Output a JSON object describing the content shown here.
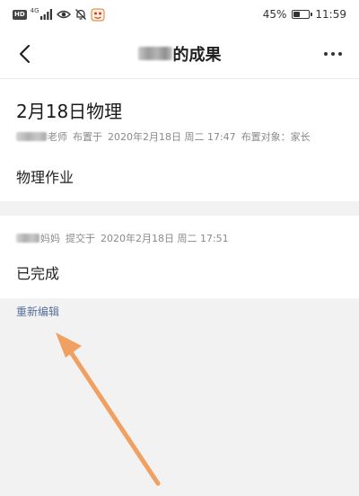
{
  "status_bar": {
    "hd_badge": "HD",
    "network_label": "4G",
    "battery_text": "45%",
    "battery_level": 0.45,
    "time": "11:59"
  },
  "nav": {
    "title_suffix": "的成果",
    "back_icon": "chevron-left-icon",
    "more_icon": "more-dots-icon"
  },
  "assignment": {
    "title": "2月18日物理",
    "author_role": "老师",
    "assigned_label": "布置于",
    "assigned_time": "2020年2月18日 周二 17:47",
    "target_label": "布置对象：家长",
    "content": "物理作业"
  },
  "submission": {
    "submitter_role": "妈妈",
    "submitted_label": "提交于",
    "submitted_time": "2020年2月18日 周二 17:51",
    "content": "已完成"
  },
  "actions": {
    "reedit_label": "重新编辑"
  },
  "colors": {
    "link": "#56709a",
    "annotation_arrow": "#f0a060"
  }
}
